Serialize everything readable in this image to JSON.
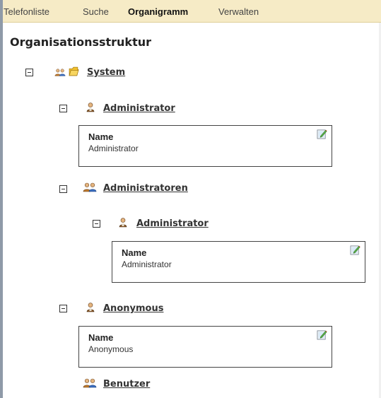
{
  "nav": {
    "items": [
      {
        "label": "Telefonliste",
        "active": false
      },
      {
        "label": "Suche",
        "active": false
      },
      {
        "label": "Organigramm",
        "active": true
      },
      {
        "label": "Verwalten",
        "active": false
      }
    ]
  },
  "page": {
    "title": "Organisationsstruktur"
  },
  "tree": {
    "system": {
      "label": "System"
    },
    "administrator": {
      "label": "Administrator",
      "name_label": "Name",
      "name_value": "Administrator"
    },
    "administratoren": {
      "label": "Administratoren"
    },
    "administratoren_admin": {
      "label": "Administrator",
      "name_label": "Name",
      "name_value": "Administrator"
    },
    "anonymous": {
      "label": "Anonymous",
      "name_label": "Name",
      "name_value": "Anonymous"
    },
    "benutzer": {
      "label": "Benutzer"
    }
  },
  "colors": {
    "nav_bg": "#f6ebc6",
    "folder": "#f2c12e",
    "user_body": "#8a5a2b",
    "group_blue": "#3b6fc2"
  }
}
